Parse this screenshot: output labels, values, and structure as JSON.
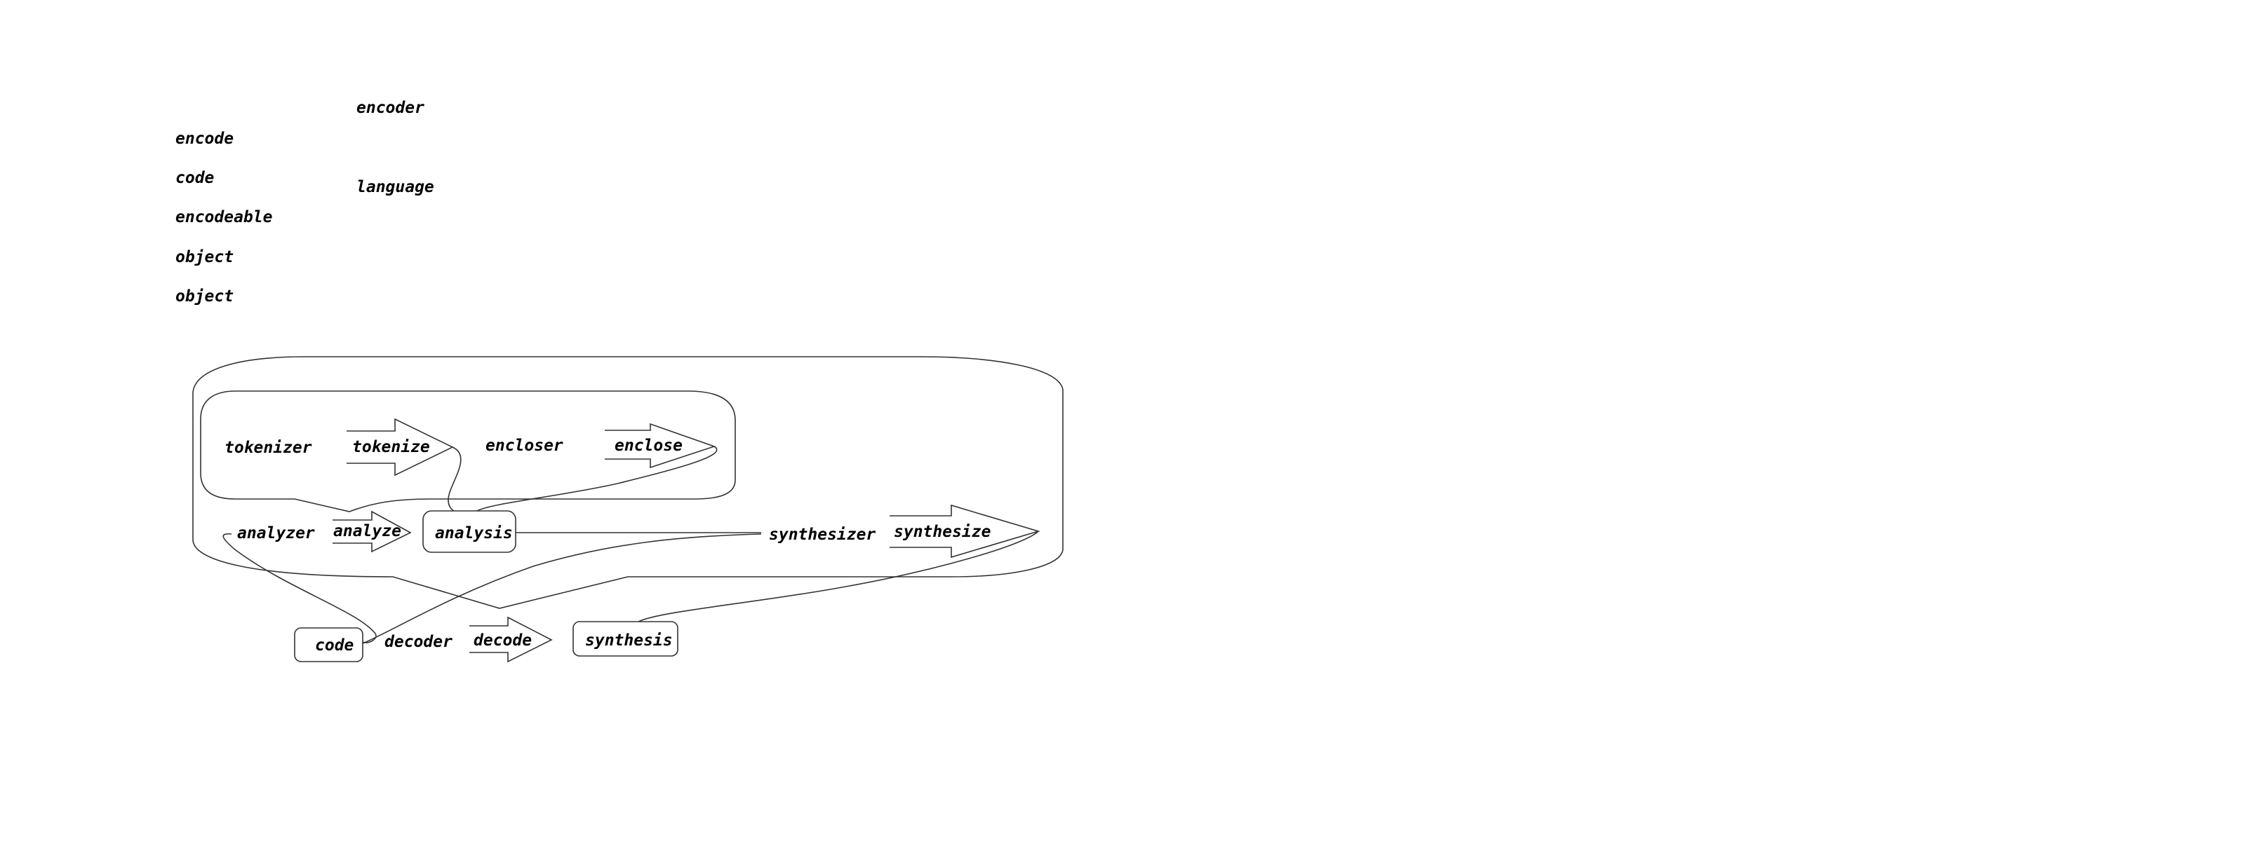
{
  "word_list": {
    "left": [
      "encode",
      "code",
      "encodeable",
      "object",
      "object"
    ],
    "right": [
      "encoder",
      "language"
    ]
  },
  "diagram": {
    "tokenizer": "tokenizer",
    "tokenize": "tokenize",
    "encloser": "encloser",
    "enclose": "enclose",
    "analyzer": "analyzer",
    "analyze": "analyze",
    "analysis": "analysis",
    "synthesizer": "synthesizer",
    "synthesize": "synthesize",
    "code": "code",
    "decoder": "decoder",
    "decode": "decode",
    "synthesis": "synthesis"
  },
  "colors": {
    "stroke": "#333333",
    "text": "#000000",
    "background": "#ffffff"
  }
}
